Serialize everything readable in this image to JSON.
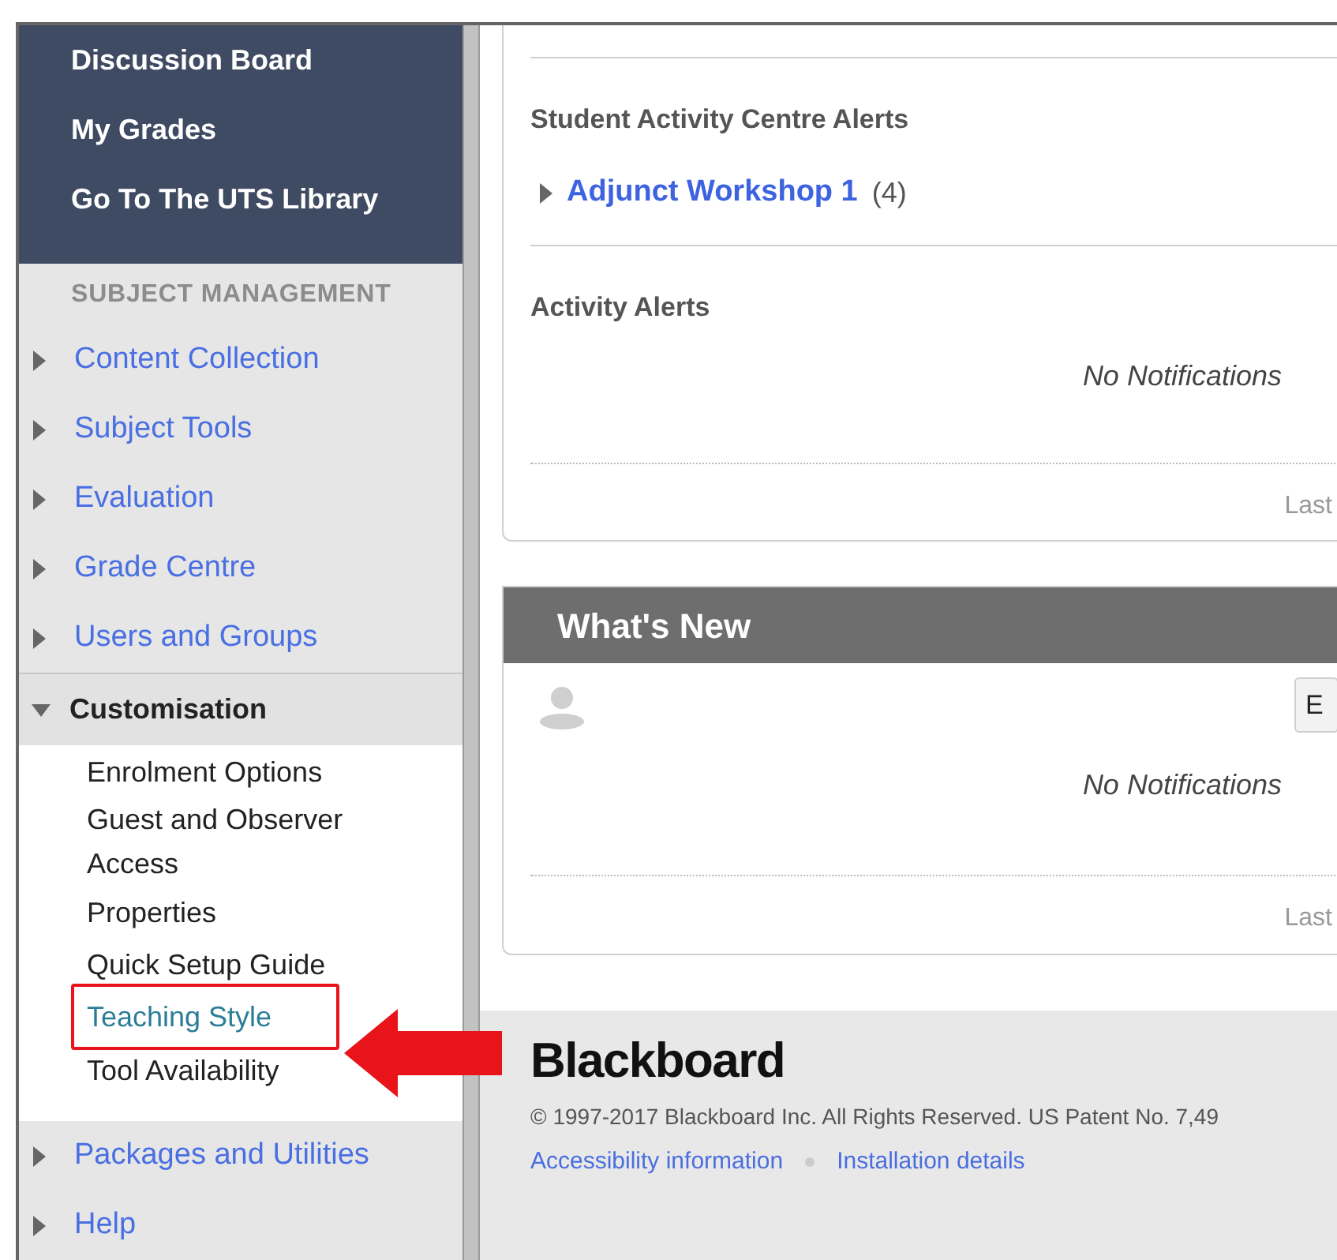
{
  "sidebar": {
    "top_links": [
      "Discussion Board",
      "My Grades",
      "Go To The UTS Library"
    ],
    "section_title": "SUBJECT MANAGEMENT",
    "menu": [
      {
        "label": "Content Collection",
        "expanded": false
      },
      {
        "label": "Subject Tools",
        "expanded": false
      },
      {
        "label": "Evaluation",
        "expanded": false
      },
      {
        "label": "Grade Centre",
        "expanded": false
      },
      {
        "label": "Users and Groups",
        "expanded": false
      },
      {
        "label": "Customisation",
        "expanded": true,
        "children": [
          {
            "label": "Enrolment Options",
            "selected": false
          },
          {
            "label": "Guest and Observer Access",
            "selected": false
          },
          {
            "label": "Properties",
            "selected": false
          },
          {
            "label": "Quick Setup Guide",
            "selected": false
          },
          {
            "label": "Teaching Style",
            "selected": true
          },
          {
            "label": "Tool Availability",
            "selected": false
          }
        ]
      },
      {
        "label": "Packages and Utilities",
        "expanded": false
      },
      {
        "label": "Help",
        "expanded": false
      }
    ]
  },
  "alerts_card": {
    "title": "Student Activity Centre Alerts",
    "entry": {
      "label": "Adjunct Workshop 1",
      "count": "(4)",
      "expanded": false
    },
    "activity_title": "Activity Alerts",
    "message": "No Notifications",
    "footer": "Last"
  },
  "whats_new_card": {
    "title": "What's New",
    "button": "E",
    "message": "No Notifications",
    "footer": "Last"
  },
  "footer": {
    "logo": "Blackboard",
    "copyright": "© 1997-2017 Blackboard Inc. All Rights Reserved. US Patent No. 7,49",
    "links": [
      "Accessibility information",
      "Installation details"
    ]
  }
}
